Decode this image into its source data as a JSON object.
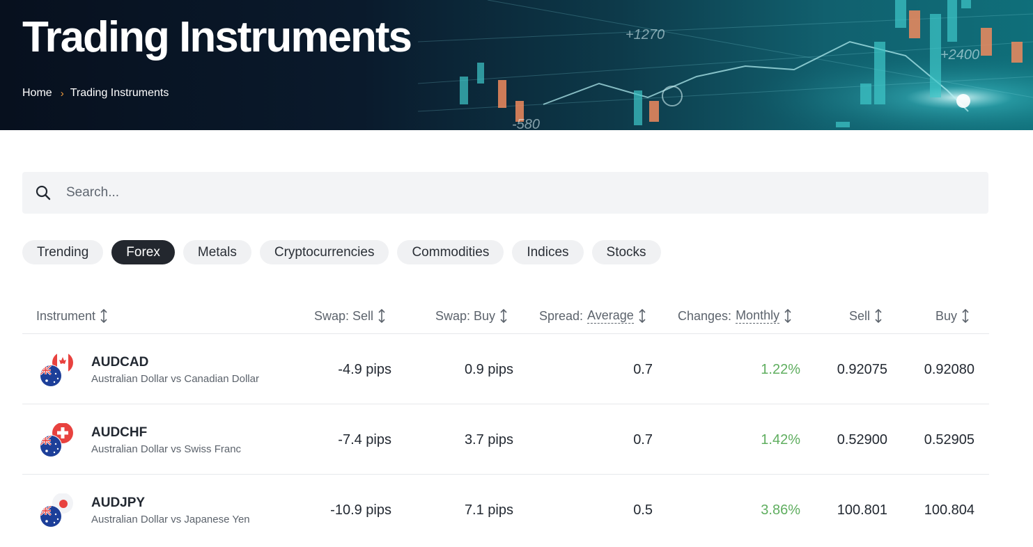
{
  "hero": {
    "title": "Trading Instruments",
    "breadcrumb": [
      {
        "label": "Home"
      },
      {
        "label": "Trading Instruments"
      }
    ],
    "art_labels": [
      "+1270",
      "+2400",
      "-580"
    ]
  },
  "search": {
    "placeholder": "Search...",
    "icon": "search-icon"
  },
  "tabs": [
    {
      "label": "Trending",
      "active": false
    },
    {
      "label": "Forex",
      "active": true
    },
    {
      "label": "Metals",
      "active": false
    },
    {
      "label": "Cryptocurrencies",
      "active": false
    },
    {
      "label": "Commodities",
      "active": false
    },
    {
      "label": "Indices",
      "active": false
    },
    {
      "label": "Stocks",
      "active": false
    }
  ],
  "table": {
    "headers": {
      "instrument": "Instrument",
      "swap_sell": "Swap: Sell",
      "swap_buy": "Swap: Buy",
      "spread_label": "Spread:",
      "spread_mode": "Average",
      "changes_label": "Changes:",
      "changes_mode": "Monthly",
      "sell": "Sell",
      "buy": "Buy"
    },
    "rows": [
      {
        "symbol": "AUDCAD",
        "description": "Australian Dollar vs Canadian Dollar",
        "swap_sell": "-4.9 pips",
        "swap_buy": "0.9 pips",
        "spread": "0.7",
        "change": "1.22%",
        "sell": "0.92075",
        "buy": "0.92080",
        "flag_base": "australia-flag-icon",
        "flag_quote": "canada-flag-icon"
      },
      {
        "symbol": "AUDCHF",
        "description": "Australian Dollar vs Swiss Franc",
        "swap_sell": "-7.4 pips",
        "swap_buy": "3.7 pips",
        "spread": "0.7",
        "change": "1.42%",
        "sell": "0.52900",
        "buy": "0.52905",
        "flag_base": "australia-flag-icon",
        "flag_quote": "switzerland-flag-icon"
      },
      {
        "symbol": "AUDJPY",
        "description": "Australian Dollar vs Japanese Yen",
        "swap_sell": "-10.9 pips",
        "swap_buy": "7.1 pips",
        "spread": "0.5",
        "change": "3.86%",
        "sell": "100.801",
        "buy": "100.804",
        "flag_base": "australia-flag-icon",
        "flag_quote": "japan-flag-icon"
      }
    ]
  },
  "colors": {
    "positive": "#5fae5f",
    "tab_active": "#23272e",
    "breadcrumb_separator": "#f39c3c"
  }
}
